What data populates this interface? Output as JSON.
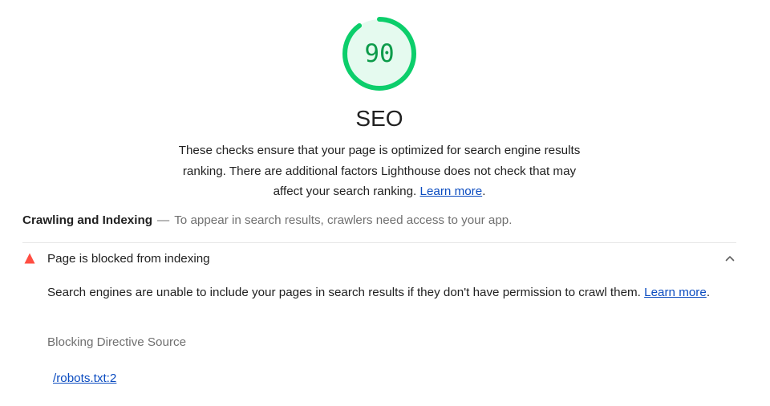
{
  "score": {
    "value": "90",
    "fraction": 0.9,
    "color": "#0cce6b",
    "fill": "#e5faef",
    "text_color": "#0c9b4a"
  },
  "category": {
    "title": "SEO",
    "description": "These checks ensure that your page is optimized for search engine results ranking. There are additional factors Lighthouse does not check that may affect your search ranking.",
    "learn_more": "Learn more",
    "trailing": "."
  },
  "group": {
    "title": "Crawling and Indexing",
    "separator": "—",
    "description": "To appear in search results, crawlers need access to your app."
  },
  "audit": {
    "status": "fail",
    "status_icon": "warning-triangle-icon",
    "status_color": "#ff4e42",
    "title": "Page is blocked from indexing",
    "expand_icon": "chevron-up-icon",
    "description": "Search engines are unable to include your pages in search results if they don't have permission to crawl them.",
    "learn_more": "Learn more",
    "trailing": ".",
    "table": {
      "header": "Blocking Directive Source",
      "rows": [
        "/robots.txt:2"
      ]
    }
  }
}
